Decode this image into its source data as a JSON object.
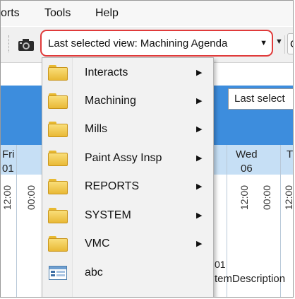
{
  "menubar": {
    "items": [
      "orts",
      "Tools",
      "Help"
    ]
  },
  "toolbar": {
    "view_selector": "Last selected view: Machining Agenda"
  },
  "tooltip": "Last select",
  "calendar": {
    "day_left": "Fri",
    "date_left": "01",
    "day_right": "Wed",
    "date_right": "06",
    "day_far": "T",
    "times": [
      "12:00",
      "00:00",
      "12:00",
      "00:00",
      "12:00",
      "00:00"
    ],
    "row_text_1": "01",
    "row_text_2": "temDescription"
  },
  "menu": {
    "items": [
      {
        "label": "Interacts",
        "icon": "folder-icon",
        "submenu": true
      },
      {
        "label": "Machining",
        "icon": "folder-icon",
        "submenu": true
      },
      {
        "label": "Mills",
        "icon": "folder-icon",
        "submenu": true
      },
      {
        "label": "Paint Assy Insp",
        "icon": "folder-icon",
        "submenu": true
      },
      {
        "label": "REPORTS",
        "icon": "folder-icon",
        "submenu": true
      },
      {
        "label": "SYSTEM",
        "icon": "folder-icon",
        "submenu": true
      },
      {
        "label": "VMC",
        "icon": "folder-icon",
        "submenu": true
      },
      {
        "label": "abc",
        "icon": "view-icon",
        "submenu": false
      }
    ]
  },
  "colors": {
    "highlight_border": "#e03a3a",
    "calendar_blue": "#3d8ddd",
    "calendar_light": "#c6dff5",
    "folder_yellow": "#f2cf5b"
  }
}
